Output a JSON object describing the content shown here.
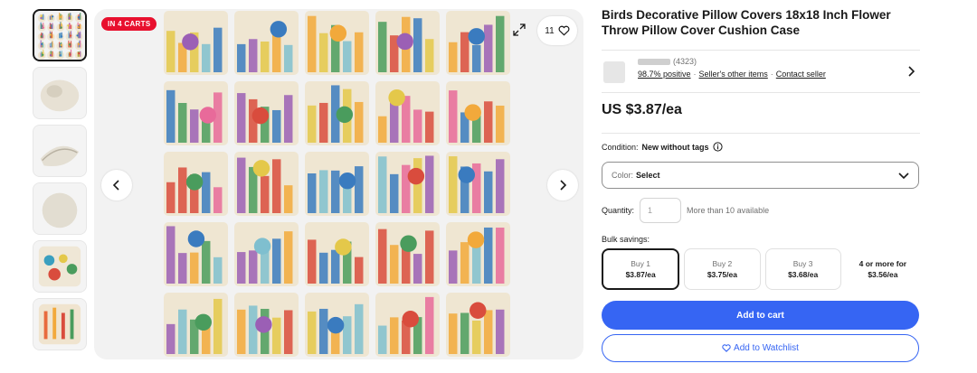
{
  "gallery": {
    "badge": "IN 4 CARTS",
    "watch_count": "11",
    "thumbnails": [
      {
        "icon": "pillow-collage"
      },
      {
        "icon": "pillow-closeup"
      },
      {
        "icon": "pillow-zipper"
      },
      {
        "icon": "pillow-back"
      },
      {
        "icon": "pillow-birds"
      },
      {
        "icon": "pillow-flowers"
      }
    ],
    "pillow_palette": [
      "#d94c3d",
      "#f2a93b",
      "#4a9c5d",
      "#3a7bbf",
      "#e4c84a",
      "#9b5fb5",
      "#e86a9a",
      "#7fbfcf"
    ]
  },
  "product": {
    "title": "Birds Decorative Pillow Covers 18x18 Inch Flower Throw Pillow Cover Cushion Case",
    "price": "US $3.87/ea"
  },
  "seller": {
    "feedback_count": "(4323)",
    "positive": "98.7% positive",
    "other_items": "Seller's other items",
    "contact": "Contact seller",
    "separator": "·"
  },
  "condition": {
    "label": "Condition:",
    "value": "New without tags"
  },
  "color_select": {
    "label": "Color:",
    "value": "Select"
  },
  "quantity": {
    "label": "Quantity:",
    "value": "1",
    "available": "More than 10 available"
  },
  "bulk": {
    "label": "Bulk savings:",
    "options": [
      {
        "qty": "Buy 1",
        "price": "$3.87/ea"
      },
      {
        "qty": "Buy 2",
        "price": "$3.75/ea"
      },
      {
        "qty": "Buy 3",
        "price": "$3.68/ea"
      },
      {
        "qty": "4 or more for",
        "price": "$3.56/ea"
      }
    ]
  },
  "actions": {
    "add_to_cart": "Add to cart",
    "add_to_watchlist": "Add to Watchlist"
  },
  "colors": {
    "accent": "#3665f3",
    "badge": "#e8102e"
  }
}
